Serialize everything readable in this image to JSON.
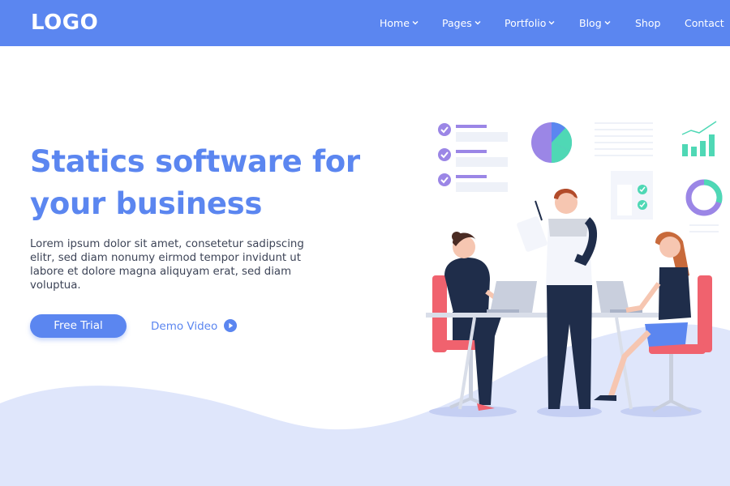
{
  "header": {
    "logo": "LOGO",
    "nav": [
      {
        "label": "Home",
        "has_dropdown": true
      },
      {
        "label": "Pages",
        "has_dropdown": true
      },
      {
        "label": "Portfolio",
        "has_dropdown": true
      },
      {
        "label": "Blog",
        "has_dropdown": true
      },
      {
        "label": "Shop",
        "has_dropdown": false
      },
      {
        "label": "Contact",
        "has_dropdown": false
      }
    ]
  },
  "hero": {
    "title_line1": "Statics software for",
    "title_line2": "your business",
    "description": "Lorem ipsum dolor sit amet, consetetur sadipscing elitr, sed diam nonumy eirmod tempor invidunt ut labore et dolore magna aliquyam erat, sed diam voluptua.",
    "primary_button": "Free Trial",
    "secondary_link": "Demo Video"
  },
  "colors": {
    "brand": "#5b86f0",
    "wave": "#dfe6fb",
    "text": "#3d4457",
    "accent_green": "#4fd8b5",
    "accent_purple": "#9b86e6",
    "chair_red": "#f0626e",
    "navy": "#1f2d4a"
  },
  "icons": {
    "nav_dropdown": "chevron-down-icon",
    "demo_video": "play-circle-icon"
  }
}
